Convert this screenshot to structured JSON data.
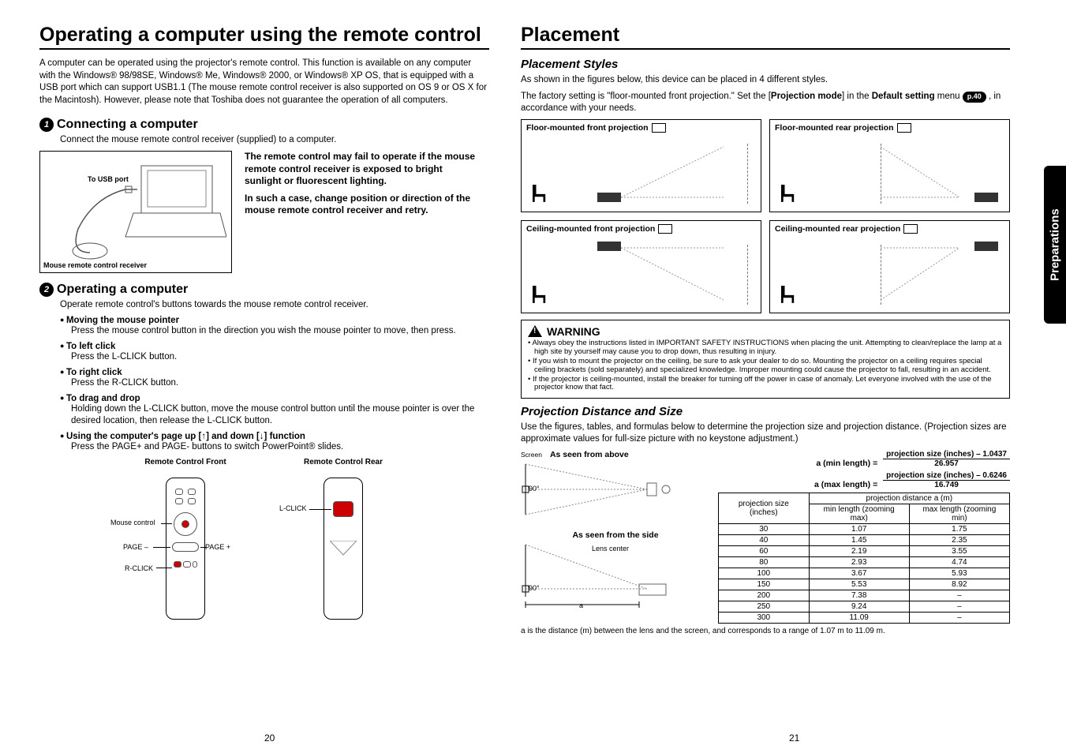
{
  "left": {
    "title": "Operating a computer using the remote control",
    "intro": "A computer can be operated using the projector's remote control.  This function is available on any computer with the Windows® 98/98SE, Windows® Me, Windows® 2000, or Windows® XP OS, that is equipped with a USB port which can support USB1.1 (The mouse remote control receiver is also supported on OS 9 or OS X for the Macintosh). However, please note that Toshiba does not guarantee the operation of all computers.",
    "s1_num": "1",
    "s1_title": "Connecting a computer",
    "s1_sub": "Connect the mouse remote control receiver (supplied) to a computer.",
    "usb_label": "To USB port",
    "receiver_label": "Mouse remote control receiver",
    "warn1": "The remote control may fail to operate if the mouse remote control receiver is exposed to bright sunlight or fluorescent lighting.",
    "warn2": "In such a case, change position or direction of the mouse remote control receiver and retry.",
    "s2_num": "2",
    "s2_title": "Operating a computer",
    "s2_sub": "Operate remote control's buttons towards the mouse remote control receiver.",
    "b1t": "Moving the mouse pointer",
    "b1d": "Press the mouse control button in the direction you wish the mouse pointer to move, then press.",
    "b2t": "To left click",
    "b2d": "Press the L-CLICK button.",
    "b3t": "To right click",
    "b3d": "Press the R-CLICK button.",
    "b4t": "To drag and drop",
    "b4d": "Holding down the L-CLICK button, move the mouse control button until the mouse pointer is over the desired location, then release the L-CLICK button.",
    "b5t": "Using the computer's page up [↑] and down [↓] function",
    "b5d": "Press the PAGE+ and PAGE- buttons to switch PowerPoint® slides.",
    "rc_front": "Remote Control Front",
    "rc_rear": "Remote Control Rear",
    "lbl_mouse": "Mouse control",
    "lbl_page_minus": "PAGE –",
    "lbl_page_plus": "PAGE +",
    "lbl_rclick": "R-CLICK",
    "lbl_lclick": "L-CLICK",
    "page_num": "20"
  },
  "right": {
    "title": "Placement",
    "h_styles": "Placement Styles",
    "styles_intro1": "As shown in the figures below, this device can be placed in 4 different styles.",
    "styles_intro2_a": "The factory setting is \"floor-mounted front projection.\" Set the [",
    "styles_intro2_b": "Projection mode",
    "styles_intro2_c": "] in the ",
    "styles_intro2_d": "Default setting",
    "styles_intro2_e": " menu ",
    "pref": "p.40",
    "styles_intro2_f": " , in accordance with your needs.",
    "pm1": "Floor-mounted front projection",
    "pm2": "Floor-mounted rear projection",
    "pm3": "Ceiling-mounted front projection",
    "pm4": "Ceiling-mounted rear projection",
    "warn_title": "WARNING",
    "w1": "Always obey the instructions listed in IMPORTANT SAFETY INSTRUCTIONS when placing the unit. Attempting to clean/replace the lamp at a high site by yourself may cause you to drop down, thus resulting in injury.",
    "w2": "If you wish to mount the projector on the ceiling, be sure to ask your dealer to do so. Mounting the projector on a ceiling requires special ceiling brackets (sold separately) and specialized knowledge. Improper mounting could cause the projector to fall, resulting in an accident.",
    "w3": "If the projector is ceiling-mounted, install the breaker for turning off the power in case of anomaly. Let everyone involved with the use of the projector know that fact.",
    "h_dist": "Projection Distance and Size",
    "dist_intro": "Use the figures, tables, and formulas below to determine the projection size and projection distance. (Projection sizes are approximate values for full-size picture with no keystone adjustment.)",
    "f1_label": "a (min length) =",
    "f1_top": "projection size (inches) – 1.0437",
    "f1_bot": "26.957",
    "f2_label": "a (max length) =",
    "f2_top": "projection size (inches) – 0.6246",
    "f2_bot": "16.749",
    "screen_label": "Screen",
    "view_top": "As seen from above",
    "view_side": "As seen from the side",
    "lens_center": "Lens center",
    "deg90a": "90°",
    "deg90b": "90°",
    "a_letter": "a",
    "footnote": "a is the distance (m) between the lens and the screen, and corresponds to a range of 1.07 m to 11.09 m.",
    "th1": "projection size (inches)",
    "th2": "projection distance a (m)",
    "th3": "min length (zooming max)",
    "th4": "max length (zooming min)",
    "page_num": "21",
    "side_tab": "Preparations"
  },
  "chart_data": {
    "type": "table",
    "title": "Projection Distance and Size",
    "columns": [
      "projection size (inches)",
      "min length (zooming max)",
      "max length (zooming min)"
    ],
    "rows": [
      [
        30,
        1.07,
        1.75
      ],
      [
        40,
        1.45,
        2.35
      ],
      [
        60,
        2.19,
        3.55
      ],
      [
        80,
        2.93,
        4.74
      ],
      [
        100,
        3.67,
        5.93
      ],
      [
        150,
        5.53,
        8.92
      ],
      [
        200,
        7.38,
        null
      ],
      [
        250,
        9.24,
        null
      ],
      [
        300,
        11.09,
        null
      ]
    ]
  }
}
